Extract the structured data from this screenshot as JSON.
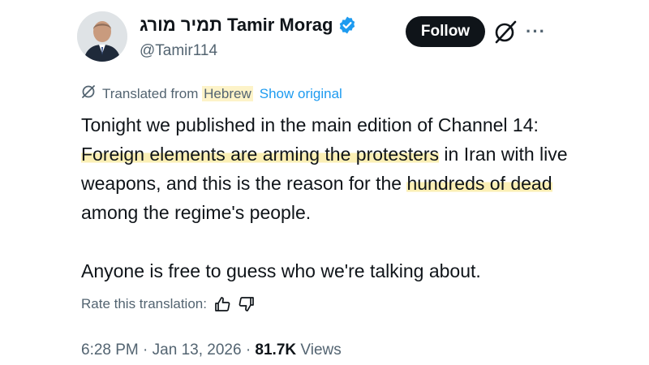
{
  "author": {
    "display_name": "תמיר מורג Tamir Morag",
    "handle": "@Tamir114",
    "verified": true
  },
  "follow_button": {
    "label": "Follow"
  },
  "translation": {
    "translated_from": "Translated from",
    "language": "Hebrew",
    "show_original": "Show original"
  },
  "tweet": {
    "part1": "Tonight we published in the main edition of Channel 14: ",
    "highlight1": "Foreign elements are arming the protesters",
    "part2": " in Iran with live weapons, and this is the reason for the ",
    "highlight2": "hundreds of dead",
    "part3": " among the regime's people.",
    "paragraph2": "Anyone is free to guess who we're talking about."
  },
  "rate": {
    "label": "Rate this translation:"
  },
  "meta": {
    "time": "6:28 PM",
    "separator": "·",
    "date": "Jan 13, 2026",
    "views_count": "81.7K",
    "views_label": "Views"
  },
  "colors": {
    "text": "#0f1419",
    "secondary": "#536471",
    "link": "#1d9bf0",
    "highlight": "#fbefb5",
    "verified": "#1d9bf0"
  }
}
